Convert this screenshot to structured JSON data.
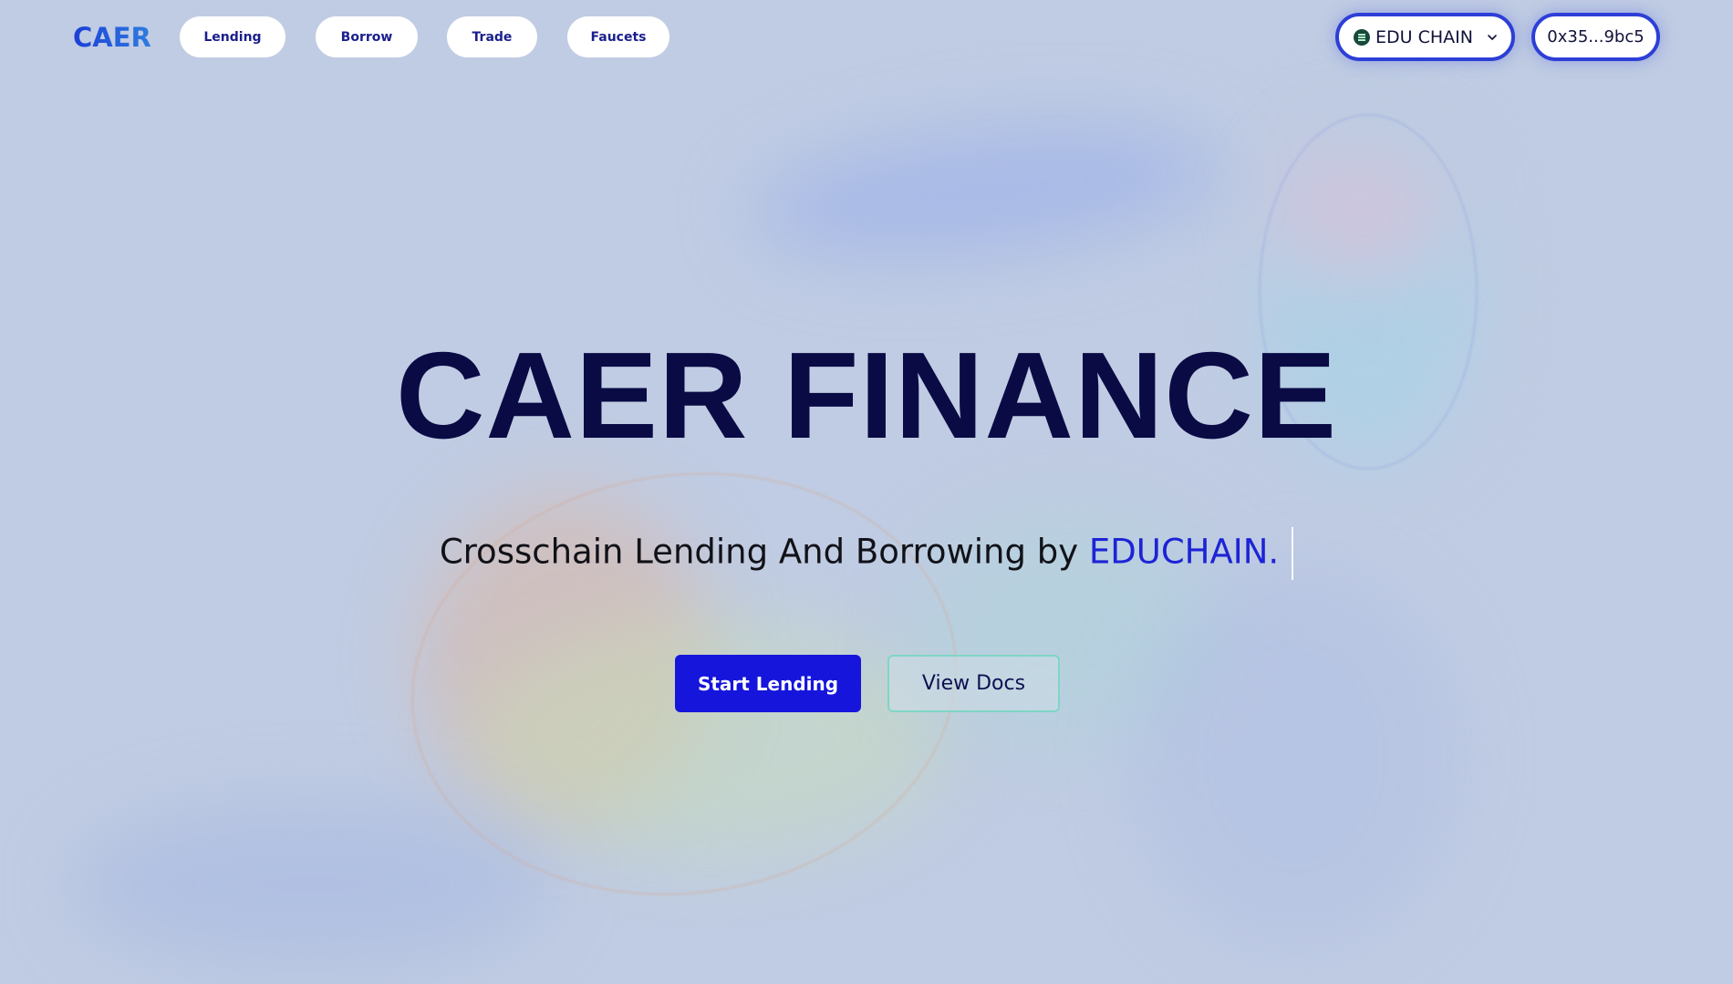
{
  "nav": {
    "logo": "CAER",
    "links": [
      {
        "label": "Lending"
      },
      {
        "label": "Borrow"
      },
      {
        "label": "Trade"
      },
      {
        "label": "Faucets"
      }
    ],
    "chain_selector": {
      "label": "EDU CHAIN",
      "icon": "edu-chain-icon"
    },
    "wallet": {
      "address": "0x35...9bc5"
    }
  },
  "hero": {
    "title": "CAER FINANCE",
    "subtitle_prefix": "Crosschain Lending And Borrowing by ",
    "subtitle_accent": "EDUCHAIN.",
    "primary_cta": "Start Lending",
    "secondary_cta": "View Docs"
  },
  "colors": {
    "background": "#c0cce3",
    "title": "#0a0b45",
    "accent": "#1d23d6",
    "primary_button": "#1515dc",
    "wallet_border": "#2d3fd6",
    "secondary_border": "#7fd6c6"
  }
}
